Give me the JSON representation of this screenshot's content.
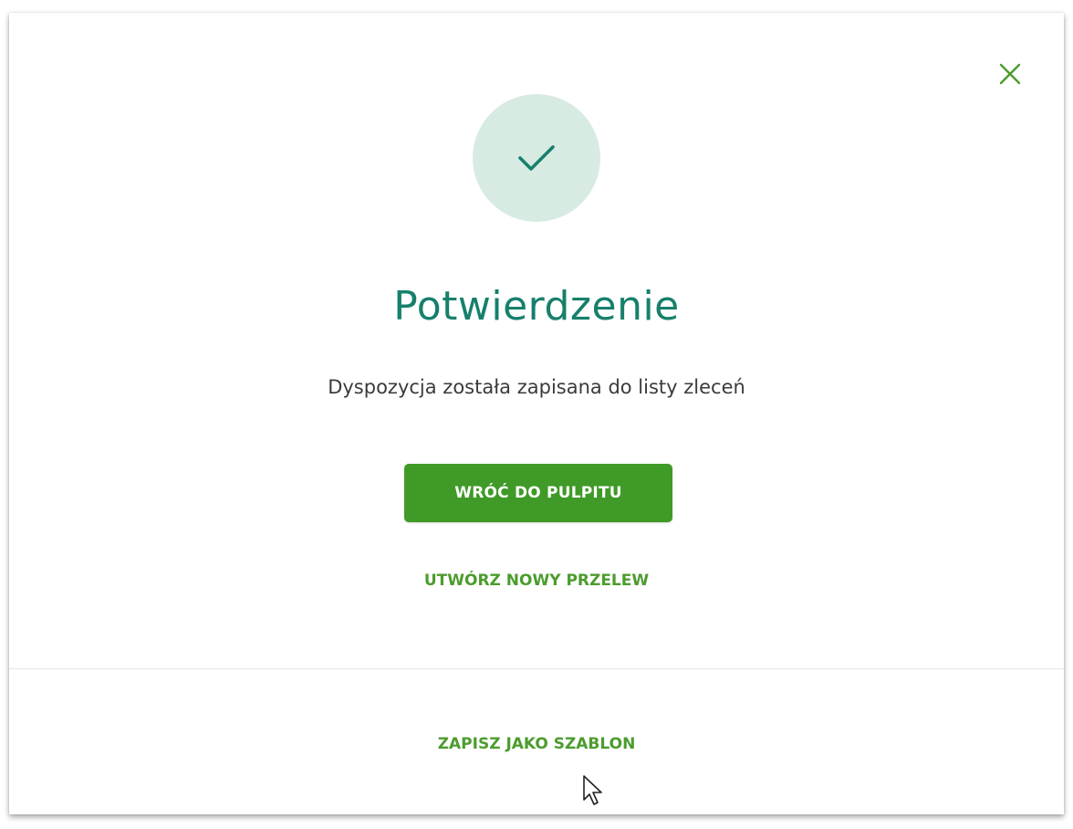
{
  "dialog": {
    "close_icon": "close-icon",
    "status_icon": "checkmark-icon",
    "title": "Potwierdzenie",
    "message": "Dyspozycja została zapisana do listy zleceń",
    "primary_button_label": "WRÓĆ DO PULPITU",
    "secondary_link_label": "UTWÓRZ NOWY PRZELEW",
    "footer_link_label": "ZAPISZ JAKO SZABLON"
  },
  "colors": {
    "accent_green": "#3f9a27",
    "title_teal": "#16806b",
    "badge_bg": "#d7ebe2",
    "text_dark": "#3b3b3b"
  }
}
